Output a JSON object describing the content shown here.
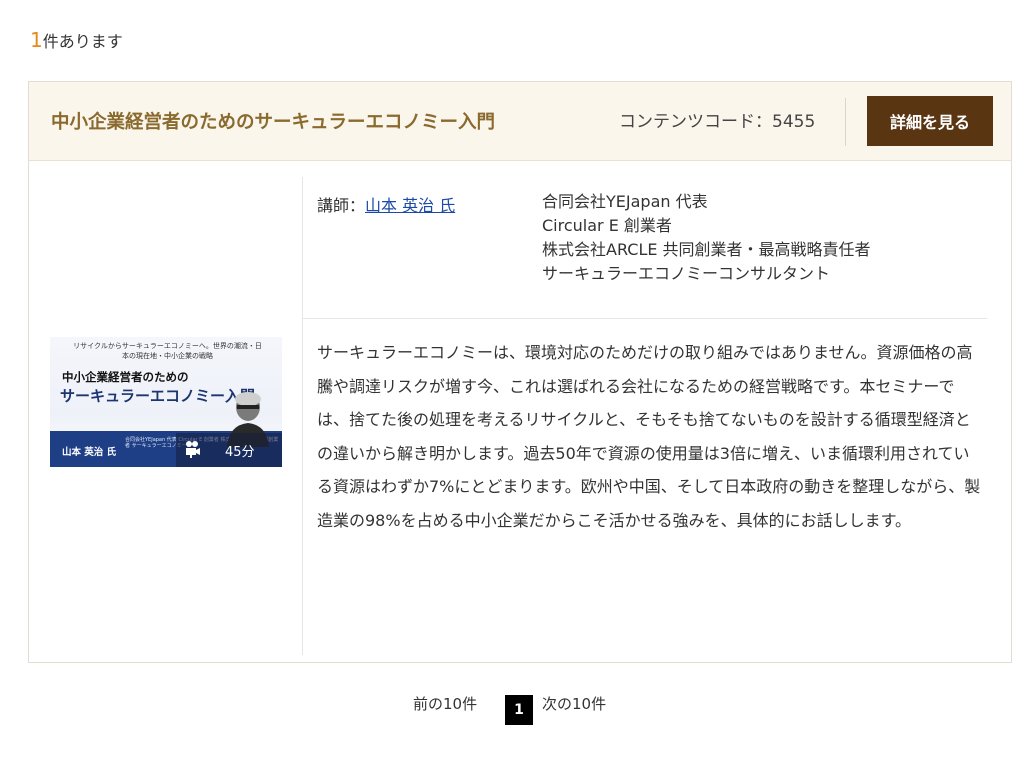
{
  "results": {
    "count": "1",
    "suffix": "件あります"
  },
  "item": {
    "title": "中小企業経営者のためのサーキュラーエコノミー入門",
    "code_label": "コンテンツコード：",
    "code_value": "5455",
    "detail_button": "詳細を見る",
    "lecturer_label": "講師：",
    "lecturer_name": "山本 英治 氏",
    "lecturer_info": [
      "合同会社YEJapan 代表",
      "Circular E 創業者",
      "株式会社ARCLE 共同創業者・最高戦略責任者",
      "サーキュラーエコノミーコンサルタント"
    ],
    "description": "サーキュラーエコノミーは、環境対応のためだけの取り組みではありません。資源価格の高騰や調達リスクが増す今、これは選ばれる会社になるための経営戦略です。本セミナーでは、捨てた後の処理を考えるリサイクルと、そもそも捨てないものを設計する循環型経済との違いから解き明かします。過去50年で資源の使用量は3倍に増え、いま循環利用されている資源はわずか7%にとどまります。欧州や中国、そして日本政府の動きを整理しながら、製造業の98%を占める中小企業だからこそ活かせる強みを、具体的にお話しします。",
    "thumbnail": {
      "subtitle": "リサイクルからサーキュラーエコノミーへ。世界の潮流・日本の現在地・中小企業の戦略",
      "title_line1": "中小企業経営者のための",
      "title_line2": "サーキュラーエコノミー入門",
      "name": "山本 英治 氏",
      "small_text": "合同会社YEJapan 代表 Circular E 創業者 株式会社ARCLE 共同創業者 サーキュラーエコノミー…",
      "duration": "45分"
    }
  },
  "pagination": {
    "prev": "前の10件",
    "current": "1",
    "next": "次の10件"
  }
}
